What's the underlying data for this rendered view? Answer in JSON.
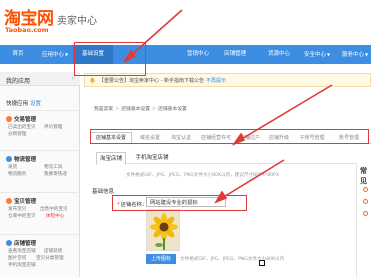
{
  "header": {
    "logo_cn": "淘宝网",
    "logo_en": "Taobao.com",
    "title": "卖家中心"
  },
  "topnav": {
    "items": [
      {
        "label": "首页"
      },
      {
        "label": "应用中心"
      },
      {
        "label": "基础设置"
      },
      {
        "label": "营销中心"
      },
      {
        "label": "店铺管理"
      },
      {
        "label": "货源中心"
      },
      {
        "label": "安全中心"
      },
      {
        "label": "服务中心"
      }
    ]
  },
  "sidebar": {
    "title": "我的应用",
    "arrow": "›",
    "quick_label": "快捷应用",
    "quick_setting": "设置",
    "sections": [
      {
        "title": "交易管理",
        "links": [
          "已卖出的宝贝",
          "评价管理",
          "分销管理"
        ]
      },
      {
        "title": "物流管理",
        "links": [
          "发货",
          "物流工具",
          "物流服务",
          "我要寄快递"
        ]
      },
      {
        "title": "宝贝管理",
        "links": [
          "发布宝贝",
          "出售中的宝贝",
          "仓库中的宝贝",
          "体检中心"
        ]
      },
      {
        "title": "店铺管理",
        "links": [
          "查看淘宝店铺",
          "店铺装修",
          "图片空间",
          "宝贝分类管理",
          "手机淘宝店铺"
        ]
      }
    ]
  },
  "main": {
    "notice_text": "【重要公告】淘宝卖家中心 - 新手指南下载公告",
    "notice_close": "不再提示",
    "breadcrumb": [
      "我是卖家",
      "店铺基本设置",
      "店铺基本设置"
    ],
    "tabs": [
      {
        "label": "店铺基本设置"
      },
      {
        "label": "域名设置"
      },
      {
        "label": "淘宝认证"
      },
      {
        "label": "店铺经营许可"
      },
      {
        "label": "店铺过户"
      },
      {
        "label": "店铺升级"
      },
      {
        "label": "子账号管理"
      },
      {
        "label": "账号管理"
      }
    ],
    "subtabs": [
      {
        "label": "淘宝店铺"
      },
      {
        "label": "手机淘宝店铺"
      }
    ],
    "logo_hint": "文件格式GIF、JPG、JPEG、PNG文件大小80K以内，建议尺寸80PX*80PX",
    "basic_info": "基础信息",
    "form": {
      "shop_name_label": "店铺名称：",
      "shop_name_value": "网站建设专业的鼠标"
    },
    "upload_label": "上传图标",
    "bottom_hint": "文件格式GIF、JPG、JPEG、PNG文件大小80K以内"
  },
  "right_panel": {
    "title": "常见"
  },
  "colors": {
    "brand_orange": "#ff5000",
    "nav_blue": "#3d8ee3",
    "annotation_red": "#e03b3b"
  }
}
